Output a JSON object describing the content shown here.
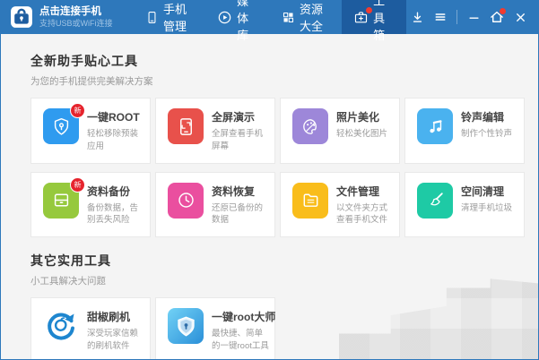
{
  "colors": {
    "topbar": "#2e78bb",
    "topbar_active_tab": "#1d5c9f",
    "badge_red": "#e6242d",
    "content_bg": "#f4f4f4"
  },
  "topbar": {
    "connect": {
      "title": "点击连接手机",
      "subtitle": "支持USB或WiFi连接"
    },
    "tabs": [
      {
        "label": "手机管理",
        "icon": "phone-icon",
        "active": false,
        "badge": false
      },
      {
        "label": "媒体库",
        "icon": "media-play-icon",
        "active": false,
        "badge": false
      },
      {
        "label": "资源大全",
        "icon": "grid-icon",
        "active": false,
        "badge": false
      },
      {
        "label": "工具箱",
        "icon": "toolbox-icon",
        "active": true,
        "badge": true
      }
    ],
    "window_controls": [
      {
        "name": "download",
        "icon": "download-icon"
      },
      {
        "name": "menu",
        "icon": "menu-icon"
      },
      {
        "name": "separator"
      },
      {
        "name": "minimize",
        "icon": "minimize-icon"
      },
      {
        "name": "home",
        "icon": "home-icon",
        "badge": true
      },
      {
        "name": "close",
        "icon": "close-icon"
      }
    ]
  },
  "sections": [
    {
      "title": "全新助手贴心工具",
      "subtitle": "为您的手机提供完美解决方案",
      "tools": [
        {
          "name": "一键ROOT",
          "desc": "轻松移除预装应用",
          "color": "#2f9bef",
          "icon": "shield-key-icon",
          "badge": "新"
        },
        {
          "name": "全屏演示",
          "desc": "全屏查看手机屏幕",
          "color": "#e8514b",
          "icon": "screen-cast-icon",
          "badge": ""
        },
        {
          "name": "照片美化",
          "desc": "轻松美化图片",
          "color": "#9d87d9",
          "icon": "palette-icon",
          "badge": ""
        },
        {
          "name": "铃声编辑",
          "desc": "制作个性铃声",
          "color": "#4ab2ef",
          "icon": "music-note-icon",
          "badge": ""
        },
        {
          "name": "资料备份",
          "desc": "备份数据，告别丢失风险",
          "color": "#96c93d",
          "icon": "backup-drawer-icon",
          "badge": "新"
        },
        {
          "name": "资料恢复",
          "desc": "还原已备份的数据",
          "color": "#ea4f9f",
          "icon": "restore-clock-icon",
          "badge": ""
        },
        {
          "name": "文件管理",
          "desc": "以文件夹方式查看手机文件",
          "color": "#f9bd1b",
          "icon": "folder-icon",
          "badge": ""
        },
        {
          "name": "空间清理",
          "desc": "清理手机垃圾",
          "color": "#1ecaa5",
          "icon": "clean-brush-icon",
          "badge": ""
        }
      ]
    },
    {
      "title": "其它实用工具",
      "subtitle": "小工具解决大问题",
      "tools": [
        {
          "name": "甜椒刷机",
          "desc": "深受玩家信赖的刷机软件",
          "color": "",
          "icon": "flash-ring-icon",
          "badge": ""
        },
        {
          "name": "一键root大师",
          "desc": "最快捷、简单的一键root工具",
          "color": "appicon",
          "icon": "root-master-shield-icon",
          "badge": ""
        }
      ]
    }
  ]
}
